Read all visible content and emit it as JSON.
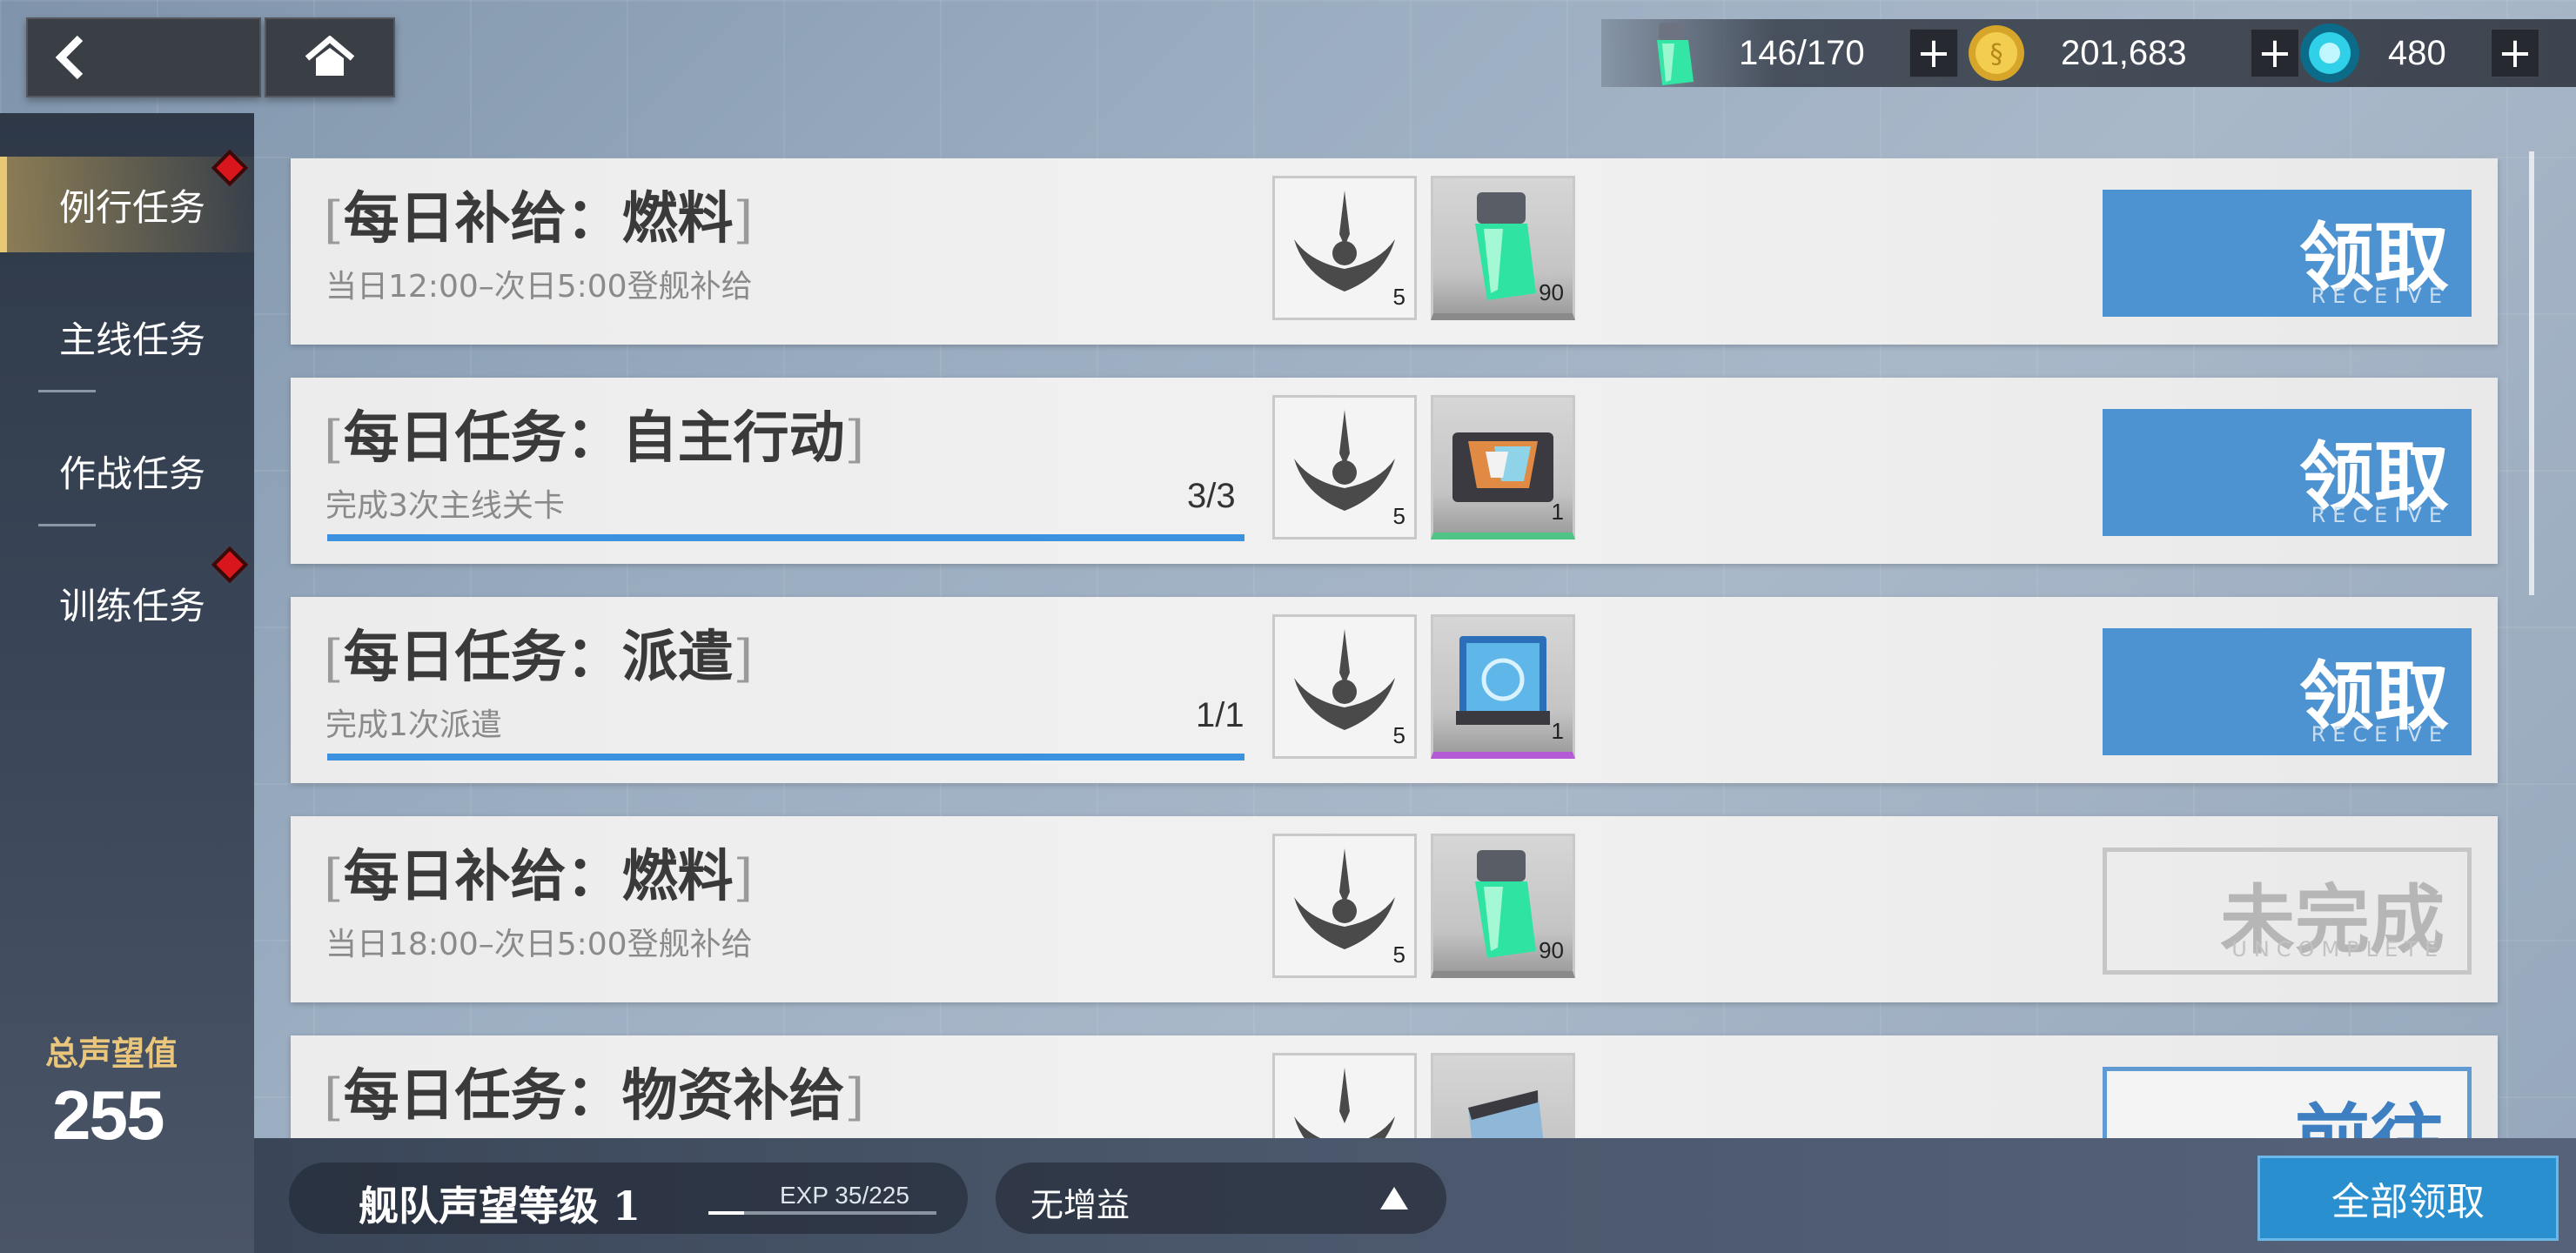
{
  "resources": [
    {
      "icon": "fuel-icon",
      "value": "146/170"
    },
    {
      "icon": "coin-icon",
      "value": "201,683"
    },
    {
      "icon": "crystal-icon",
      "value": "480"
    }
  ],
  "sidebar": {
    "items": [
      {
        "label": "例行任务",
        "active": true,
        "badge": true
      },
      {
        "label": "主线任务",
        "active": false,
        "badge": false
      },
      {
        "label": "作战任务",
        "active": false,
        "badge": false
      },
      {
        "label": "训练任务",
        "active": false,
        "badge": true
      }
    ],
    "fame_label": "总声望值",
    "fame_value": "255"
  },
  "tasks": [
    {
      "title": "每日补给：燃料",
      "desc": "当日12:00–次日5:00登舰补给",
      "progress": null,
      "rewards": [
        {
          "icon": "emblem-icon",
          "qty": "5"
        },
        {
          "icon": "fuel-cell-icon",
          "qty": "90",
          "rarity": "gray"
        }
      ],
      "action": {
        "cn": "领取",
        "en": "RECEIVE",
        "state": "receive"
      }
    },
    {
      "title": "每日任务：自主行动",
      "desc": "完成3次主线关卡",
      "progress": "3/3",
      "progress_fraction": 1.0,
      "rewards": [
        {
          "icon": "emblem-icon",
          "qty": "5"
        },
        {
          "icon": "chip-icon",
          "qty": "1",
          "rarity": "green"
        }
      ],
      "action": {
        "cn": "领取",
        "en": "RECEIVE",
        "state": "receive"
      }
    },
    {
      "title": "每日任务：派遣",
      "desc": "完成1次派遣",
      "progress": "1/1",
      "progress_fraction": 1.0,
      "rewards": [
        {
          "icon": "emblem-icon",
          "qty": "5"
        },
        {
          "icon": "blueprint-icon",
          "qty": "1",
          "rarity": "purple"
        }
      ],
      "action": {
        "cn": "领取",
        "en": "RECEIVE",
        "state": "receive"
      }
    },
    {
      "title": "每日补给：燃料",
      "desc": "当日18:00–次日5:00登舰补给",
      "progress": null,
      "rewards": [
        {
          "icon": "emblem-icon",
          "qty": "5"
        },
        {
          "icon": "fuel-cell-icon",
          "qty": "90",
          "rarity": "gray"
        }
      ],
      "action": {
        "cn": "未完成",
        "en": "UNCOMPLETE",
        "state": "uncomplete"
      }
    },
    {
      "title": "每日任务：物资补给",
      "desc": "",
      "progress": null,
      "rewards": [
        {
          "icon": "emblem-icon",
          "qty": ""
        },
        {
          "icon": "supply-icon",
          "qty": ""
        }
      ],
      "action": {
        "cn": "前往",
        "en": "",
        "state": "goto"
      }
    }
  ],
  "bottom": {
    "fleet_label": "舰队声望等级 1",
    "exp_label": "EXP 35/225",
    "exp_fraction": 0.156,
    "buff_label": "无增益",
    "claim_all": "全部领取"
  },
  "colors": {
    "accent_blue": "#4e93d1",
    "progress_blue": "#3d92e0",
    "badge_red": "#d8161b",
    "fame_gold": "#e9c67c"
  }
}
